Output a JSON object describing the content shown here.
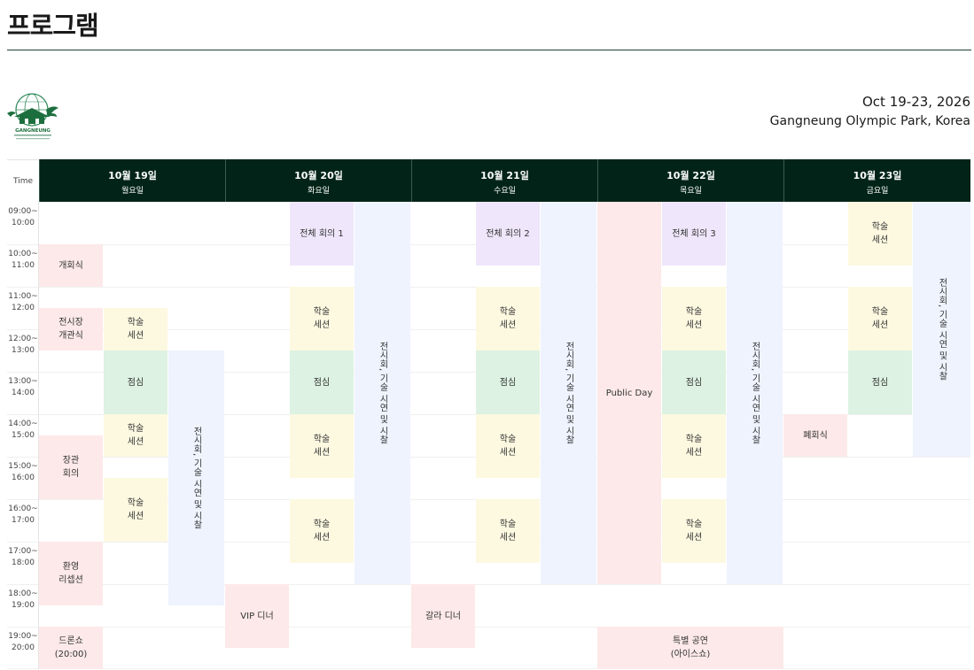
{
  "page": {
    "title": "프로그램"
  },
  "event": {
    "dates": "Oct 19-23, 2026",
    "venue": "Gangneung Olympic Park, Korea"
  },
  "logo": {
    "icon": "gangneung-congress-logo-icon",
    "text": "GANGNEUNG"
  },
  "schedule": {
    "time_header": "Time",
    "days": [
      {
        "date": "10월 19일",
        "dow": "월요일"
      },
      {
        "date": "10월 20일",
        "dow": "화요일"
      },
      {
        "date": "10월 21일",
        "dow": "수요일"
      },
      {
        "date": "10월 22일",
        "dow": "목요일"
      },
      {
        "date": "10월 23일",
        "dow": "금요일"
      }
    ],
    "times": [
      "09:00~\n10:00",
      "10:00~\n11:00",
      "11:00~\n12:00",
      "12:00~\n13:00",
      "13:00~\n14:00",
      "14:00~\n15:00",
      "15:00~\n16:00",
      "16:00~\n17:00",
      "17:00~\n18:00",
      "18:00~\n19:00",
      "19:00~\n20:00"
    ],
    "events": {
      "d1_opening": "개회식",
      "d1_exhibit_opening": "전시장\n개관식",
      "d1_session1": "학술\n세션",
      "d1_lunch": "점심",
      "d1_session2": "학술\n세션",
      "d1_ministers": "장관\n회의",
      "d1_session3": "학술\n세션",
      "d1_exhibition": "전시회, 기술 시연 및 시찰",
      "d1_reception": "환영\n리셉션",
      "d1_drone": "드론쇼\n(20:00)",
      "d2_plenary": "전체 회의 1",
      "d2_session1": "학술\n세션",
      "d2_lunch": "점심",
      "d2_session2": "학술\n세션",
      "d2_session3": "학술\n세션",
      "d2_exhibition": "전시회, 기술 시연 및 시찰",
      "d2_vip": "VIP 디너",
      "d3_plenary": "전체 회의 2",
      "d3_session1": "학술\n세션",
      "d3_lunch": "점심",
      "d3_session2": "학술\n세션",
      "d3_session3": "학술\n세션",
      "d3_exhibition": "전시회, 기술 시연 및 시찰",
      "d3_gala": "갈라 디너",
      "d4_public": "Public Day",
      "d4_plenary": "전체 회의 3",
      "d4_session1": "학술\n세션",
      "d4_lunch": "점심",
      "d4_session2": "학술\n세션",
      "d4_session3": "학술\n세션",
      "d4_exhibition": "전시회, 기술 시연 및 시찰",
      "d4_special": "특별 공연\n(아이스쇼)",
      "d5_session1": "학술\n세션",
      "d5_session2": "학술\n세션",
      "d5_lunch": "점심",
      "d5_closing": "폐회식",
      "d5_exhibition": "전시회, 기술 시연 및 시찰"
    }
  }
}
